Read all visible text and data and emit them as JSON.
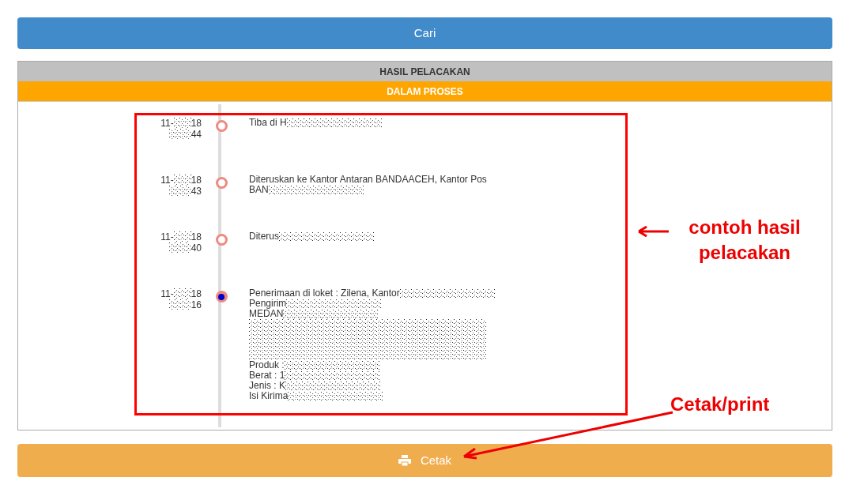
{
  "search_button": "Cari",
  "result": {
    "title": "HASIL PELACAKAN",
    "status": "DALAM PROSES",
    "events": [
      {
        "date_start": "11-",
        "date_end": "18",
        "time_end": "44",
        "current": false,
        "lines": [
          "Tiba di H"
        ]
      },
      {
        "date_start": "11-",
        "date_end": "18",
        "time_end": "43",
        "current": false,
        "lines": [
          "Diteruskan ke Kantor Antaran BANDAACEH, Kantor Pos",
          "BAN"
        ]
      },
      {
        "date_start": "11-",
        "date_end": "18",
        "time_end": "40",
        "current": false,
        "lines": [
          "Diterus"
        ]
      },
      {
        "date_start": "11-",
        "date_end": "18",
        "time_end": "16",
        "current": true,
        "lines": [
          "Penerimaan di loket : Zilena, Kantor",
          "Pengirim",
          "MEDAN"
        ],
        "lines_after": [
          "Produk :",
          "Berat : 1",
          "Jenis : K",
          "Isi Kirima"
        ]
      }
    ]
  },
  "print_button": "Cetak",
  "annotations": [
    {
      "kind": "box-callout",
      "text": "contoh hasil pelacakan"
    },
    {
      "kind": "arrow-callout",
      "text": "Cetak/print"
    }
  ]
}
